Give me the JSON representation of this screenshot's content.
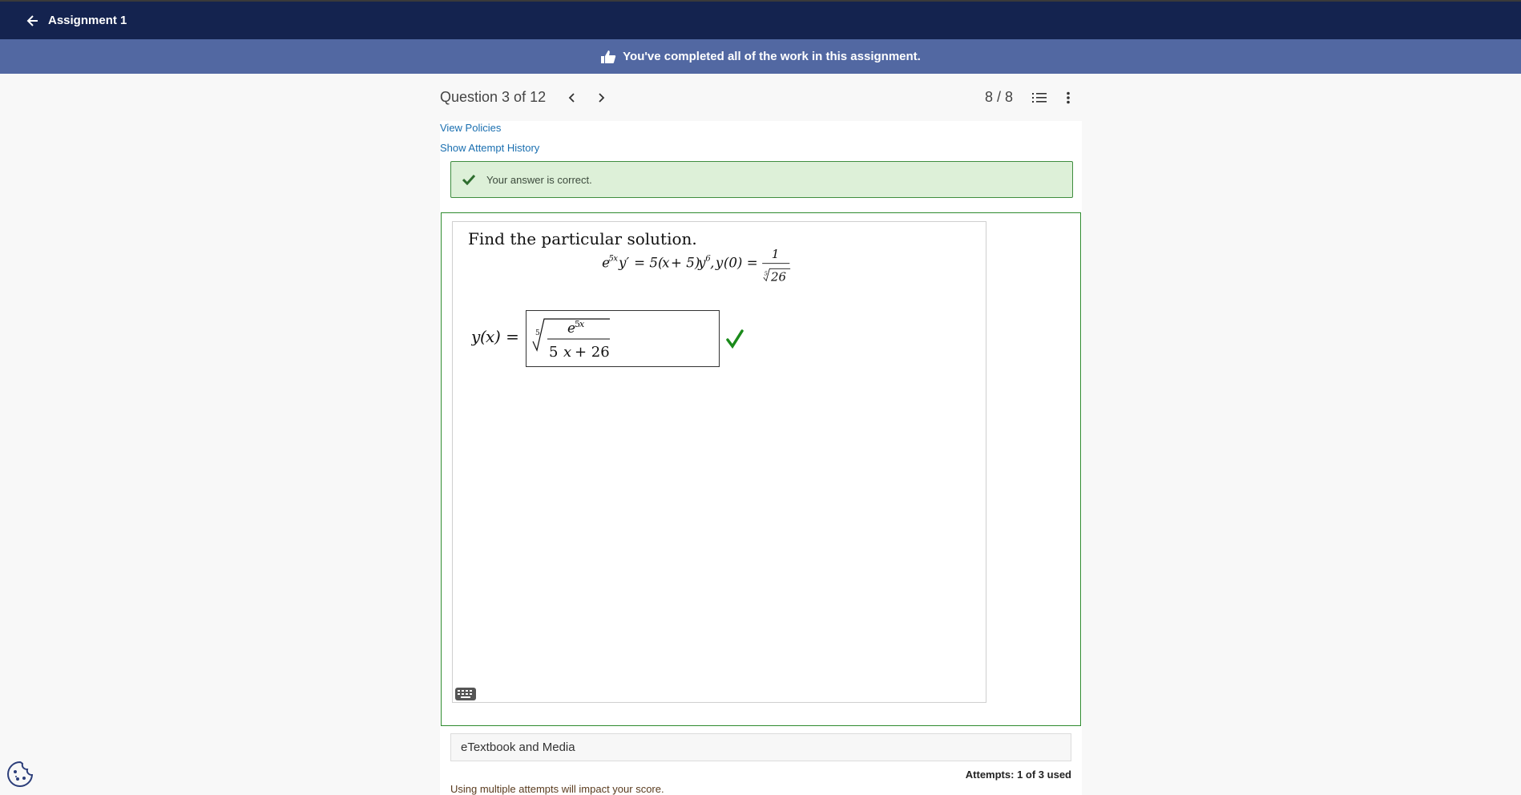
{
  "header": {
    "back_label": "Assignment 1"
  },
  "banner": {
    "text": "You've completed all of the work in this assignment."
  },
  "question": {
    "title": "Question 3 of 12",
    "score": "8 / 8",
    "links": {
      "policies": "View Policies",
      "history": "Show Attempt History"
    },
    "feedback": "Your answer is correct.",
    "prompt": "Find the particular solution.",
    "equation": "e^{5x} y' = 5(x+5) y^6, y(0) = 1/∛26 (5th root)",
    "answer_lhs": "y(x) =",
    "answer_value": "fifth-root( e^{5x} / (5 x + 26) )"
  },
  "footer": {
    "etextbook": "eTextbook and Media",
    "attempts_label": "Attempts:",
    "attempts_value": "1 of 3 used",
    "impact": "Using multiple attempts will impact your score."
  },
  "icons": [
    "back-arrow-icon",
    "thumbs-up-icon",
    "chevron-left-icon",
    "chevron-right-icon",
    "list-icon",
    "more-vertical-icon",
    "check-icon",
    "keyboard-icon",
    "cookie-icon"
  ],
  "colors": {
    "topbar": "#14234f",
    "banner": "#5268a2",
    "correct_bg": "#ddf0d8",
    "correct_border": "#3f8d3f",
    "link": "#1a6fb0"
  }
}
